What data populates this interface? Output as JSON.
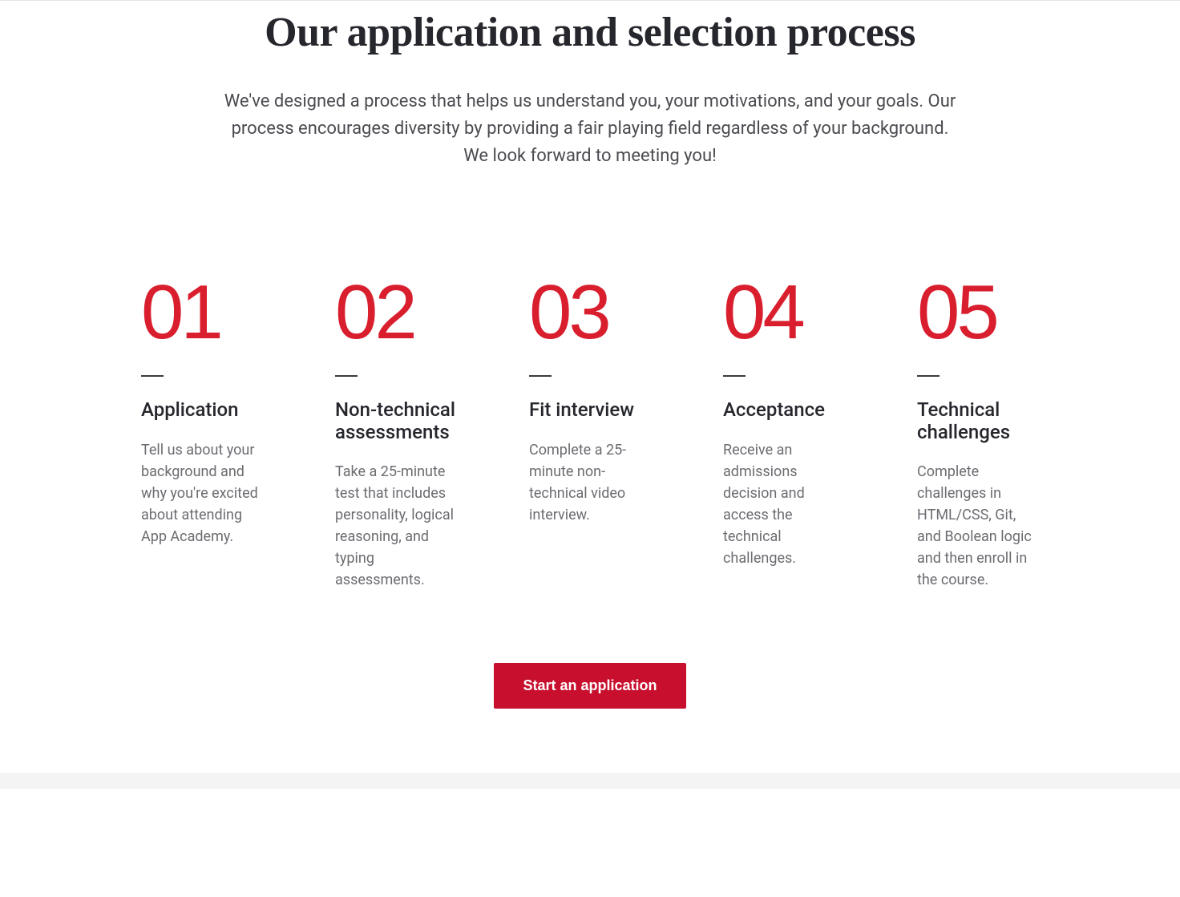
{
  "heading": "Our application and selection process",
  "intro": "We've designed a process that helps us understand you, your motivations, and your goals. Our process encourages diversity by providing a fair playing field regardless of your background. We look forward to meeting you!",
  "steps": [
    {
      "number": "01",
      "title": "Application",
      "desc": "Tell us about your background and why you're excited about attending App Academy."
    },
    {
      "number": "02",
      "title": "Non-technical assessments",
      "desc": "Take a 25-minute test that includes personality, logical reasoning, and typing assessments."
    },
    {
      "number": "03",
      "title": "Fit interview",
      "desc": "Complete a 25-minute non-technical video interview."
    },
    {
      "number": "04",
      "title": "Acceptance",
      "desc": "Receive an admissions decision and access the technical challenges."
    },
    {
      "number": "05",
      "title": "Technical challenges",
      "desc": "Complete challenges in HTML/CSS, Git, and Boolean logic and then enroll in the course."
    }
  ],
  "cta": {
    "label": "Start an application"
  },
  "colors": {
    "accent": "#d91e2e",
    "button": "#c8102e",
    "text_primary": "#26272d",
    "text_secondary": "#6b6c71"
  }
}
